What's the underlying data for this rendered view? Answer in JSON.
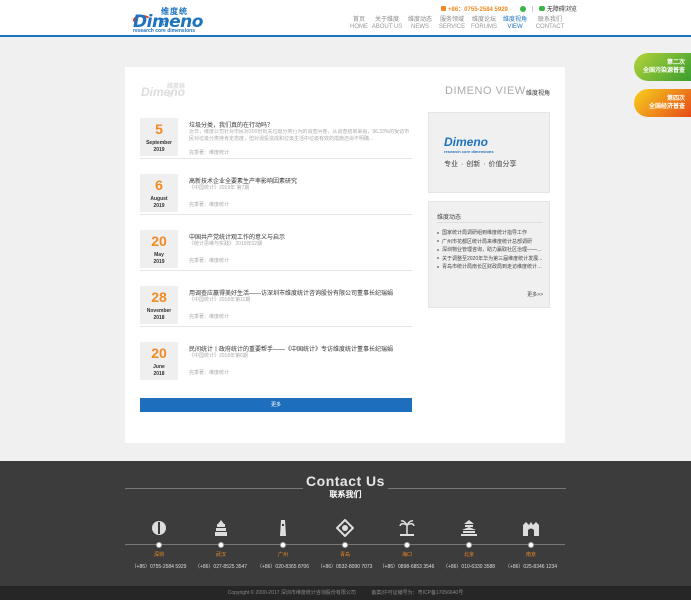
{
  "header": {
    "logo_cn": "维度统计",
    "logo_word": "Dimeno",
    "logo_sub": "research core dimensions",
    "phone": "+86：0755-2584 5929",
    "barrier_free": "无障碍浏览",
    "nav": [
      {
        "cn": "首页",
        "en": "HOME",
        "active": false
      },
      {
        "cn": "关于维度",
        "en": "ABOUT US",
        "active": false
      },
      {
        "cn": "维度动态",
        "en": "NEWS",
        "active": false
      },
      {
        "cn": "服务领域",
        "en": "SERVICE",
        "active": false
      },
      {
        "cn": "维度论坛",
        "en": "FORUMS",
        "active": false
      },
      {
        "cn": "维度视角",
        "en": "VIEW",
        "active": true
      },
      {
        "cn": "联系我们",
        "en": "CONTACT",
        "active": false
      }
    ]
  },
  "badges": [
    {
      "line1": "第二次",
      "line2": "全国污染源普查"
    },
    {
      "line1": "第四次",
      "line2": "全国经济普查"
    }
  ],
  "main": {
    "logo_word": "Dimeno",
    "logo_cn": "维度统计",
    "title_en": "DIMENO VIEW",
    "title_cn": "维度视角",
    "articles": [
      {
        "day": "5",
        "month": "September",
        "year": "2019",
        "title": "垃圾分类，我们真的在行动吗？",
        "desc": "近日，维度公司针对市民对200份有关垃圾分类行为的调查问卷，从调查结果来看，96.33%的受访市民对垃圾分类持肯定态度，但对混投造成和垃圾生活中垃圾有效的措施还尚不明确...",
        "author": "完季著：维度统计"
      },
      {
        "day": "6",
        "month": "August",
        "year": "2019",
        "title": "高新技术企业全要素生产率影响因素研究",
        "desc": "《中国统计》2019年 第7期",
        "author": "完季著：维度统计"
      },
      {
        "day": "20",
        "month": "May",
        "year": "2019",
        "title": "中国共产党统计观工作的意义与启示",
        "desc": "《统计思维与实践》 2019年02期",
        "author": "完季著：维度统计"
      },
      {
        "day": "28",
        "month": "November",
        "year": "2018",
        "title": "用调查应赢得美好生活——访深圳市维度统计咨询股份有限公司董事长纪瑞娟",
        "desc": "《中国统计》2018年第11期",
        "author": "完季著：维度统计"
      },
      {
        "day": "20",
        "month": "June",
        "year": "2018",
        "title": "民间统计丨政府统计的重要帮手——《中国统计》专访维度统计董事长纪瑞娟",
        "desc": "《中国统计》2018年第6期",
        "author": "完季著：维度统计"
      }
    ],
    "more_button": "更多"
  },
  "side": {
    "logo_word": "Dimeno",
    "logo_sub": "research core dimensions",
    "slogan": "专业 · 创新 · 价值分享",
    "news_title": "维度动态",
    "news": [
      "国家统计局调研组到维度统计指导工作",
      "广州市花都区统计局来维度统计总部调研",
      "深圳物业管理咨询，助力赢取社区治理——...",
      "关于调整至2020年华为第三届维度统计发展...",
      "青岛市统计局南长区财政局到走访维度统计公..."
    ],
    "more": "更多>>"
  },
  "footer": {
    "title_en": "Contact Us",
    "title_cn": "联系我们",
    "cities": [
      {
        "name": "深圳",
        "phone": "（+86）0755-2584 5929",
        "icon": "shenzhen-landmark-icon"
      },
      {
        "name": "武汉",
        "phone": "（+86）027-8525 3547",
        "icon": "wuhan-tower-icon"
      },
      {
        "name": "广州",
        "phone": "（+86）020-8365 8706",
        "icon": "guangzhou-tower-icon"
      },
      {
        "name": "青岛",
        "phone": "（+86）0532-8090 7073",
        "icon": "qingdao-landmark-icon"
      },
      {
        "name": "海口",
        "phone": "（+86）0898-6853 3546",
        "icon": "haikou-palm-icon"
      },
      {
        "name": "北京",
        "phone": "（+86）010-6330 3588",
        "icon": "beijing-temple-icon"
      },
      {
        "name": "南京",
        "phone": "（+86）025-8346 1234",
        "icon": "nanjing-gate-icon"
      }
    ],
    "copyright": "Copyright © 2000-2017 深圳市维度统计咨询股份有限公司",
    "icp": "备案|许可证编号为：粤ICP备17056640号"
  }
}
